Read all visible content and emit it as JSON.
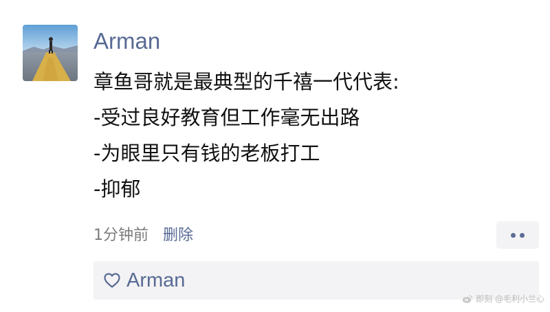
{
  "post": {
    "username": "Arman",
    "avatar_icon": "desert-road-person-photo",
    "lines": [
      "章鱼哥就是最典型的千禧一代代表:",
      "-受过良好教育但工作毫无出路",
      "-为眼里只有钱的老板打工",
      "-抑郁"
    ],
    "time": "1分钟前",
    "delete_label": "删除",
    "more_icon": "more-dots-icon"
  },
  "likes": {
    "icon": "heart-icon",
    "names": "Arman"
  },
  "watermark": {
    "icon": "weibo-icon",
    "text": "即刻 @毛利小兰心"
  },
  "colors": {
    "link": "#586a94",
    "text": "#111111",
    "muted": "#7b7b7b",
    "panel": "#f3f3f5"
  }
}
